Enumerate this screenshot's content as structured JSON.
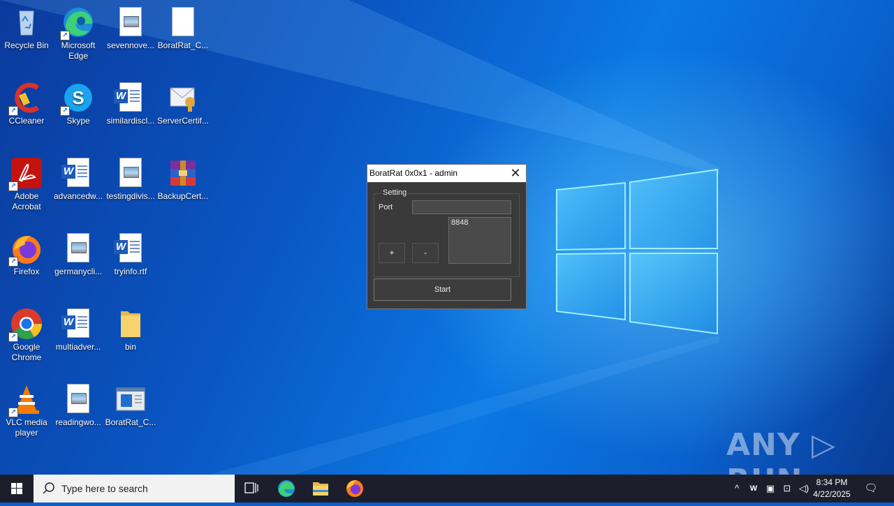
{
  "desktop": {
    "icons": [
      {
        "label": "Recycle Bin"
      },
      {
        "label": "Microsoft Edge"
      },
      {
        "label": "sevennove..."
      },
      {
        "label": "BoratRat_C..."
      },
      {
        "label": "CCleaner"
      },
      {
        "label": "Skype"
      },
      {
        "label": "similardiscl..."
      },
      {
        "label": "ServerCertif..."
      },
      {
        "label": "Adobe Acrobat"
      },
      {
        "label": "advancedw..."
      },
      {
        "label": "testingdivis..."
      },
      {
        "label": "BackupCert..."
      },
      {
        "label": "Firefox"
      },
      {
        "label": "germanycli..."
      },
      {
        "label": "tryinfo.rtf"
      },
      {
        "label": "Google Chrome"
      },
      {
        "label": "multiadver..."
      },
      {
        "label": "bin"
      },
      {
        "label": "VLC media player"
      },
      {
        "label": "readingwo..."
      },
      {
        "label": "BoratRat_C..."
      }
    ]
  },
  "dialog": {
    "title": "BoratRat 0x0x1 - admin",
    "close_glyph": "✕",
    "group_label": "Setting",
    "port_label": "Port",
    "port_value": "",
    "port_list": [
      "8848"
    ],
    "add_label": "+",
    "remove_label": "-",
    "start_label": "Start"
  },
  "watermark": {
    "text": "ANY ▷ RUN"
  },
  "taskbar": {
    "search_placeholder": "Type here to search",
    "time": "8:34 PM",
    "date": "4/22/2025",
    "pinned": [
      "task-view",
      "edge",
      "file-explorer",
      "firefox"
    ]
  }
}
